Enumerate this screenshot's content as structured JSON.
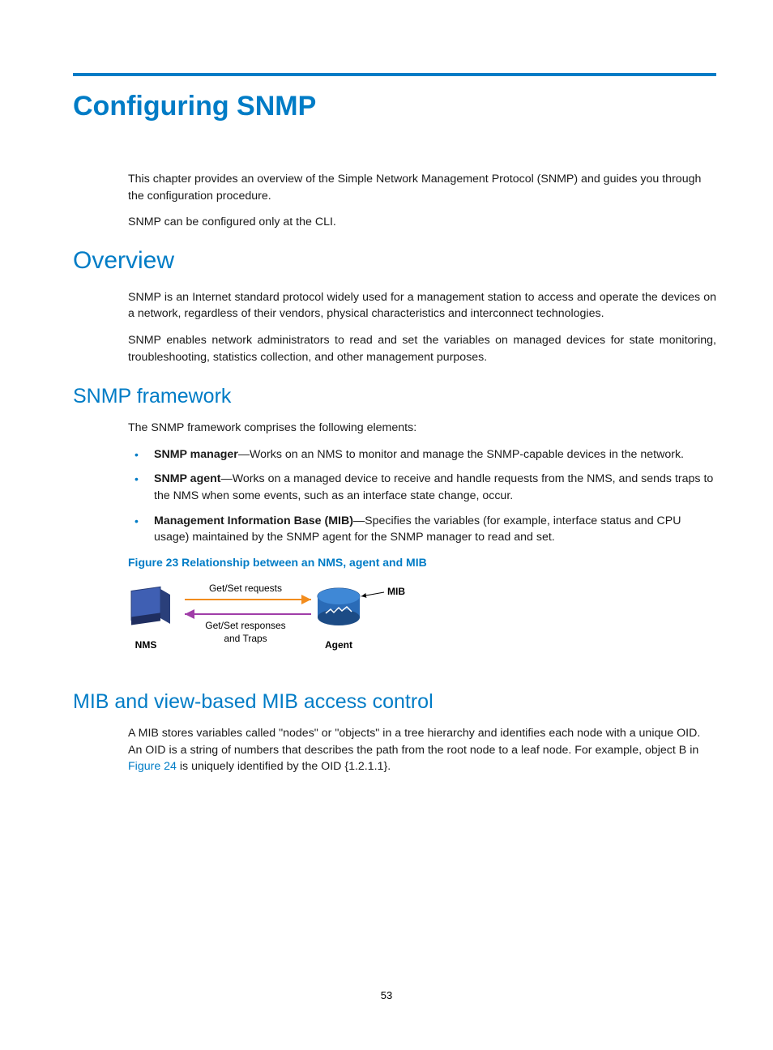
{
  "title": "Configuring SNMP",
  "intro": {
    "p1": "This chapter provides an overview of the Simple Network Management Protocol (SNMP) and guides you through the configuration procedure.",
    "p2": "SNMP can be configured only at the CLI."
  },
  "overview": {
    "heading": "Overview",
    "p1": "SNMP is an Internet standard protocol widely used for a management station to access and operate the devices on a network, regardless of their vendors, physical characteristics and interconnect technologies.",
    "p2": "SNMP enables network administrators to read and set the variables on managed devices for state monitoring, troubleshooting, statistics collection, and other management purposes."
  },
  "framework": {
    "heading": "SNMP framework",
    "lead": "The SNMP framework comprises the following elements:",
    "bullets": [
      {
        "term": "SNMP manager",
        "desc": "—Works on an NMS to monitor and manage the SNMP-capable devices in the network."
      },
      {
        "term": "SNMP agent",
        "desc": "—Works on a managed device to receive and handle requests from the NMS, and sends traps to the NMS when some events, such as an interface state change, occur."
      },
      {
        "term": "Management Information Base (MIB)",
        "desc": "—Specifies the variables (for example, interface status and CPU usage) maintained by the SNMP agent for the SNMP manager to read and set."
      }
    ],
    "figure_caption": "Figure 23 Relationship between an NMS, agent and MIB",
    "figure_labels": {
      "nms": "NMS",
      "agent": "Agent",
      "mib": "MIB",
      "req": "Get/Set requests",
      "resp1": "Get/Set responses",
      "resp2": "and Traps"
    }
  },
  "mib": {
    "heading": "MIB and view-based MIB access control",
    "p1a": "A MIB stores variables called \"nodes\" or \"objects\" in a tree hierarchy and identifies each node with a unique OID. An OID is a string of numbers that describes the path from the root node to a leaf node. For example, object B in ",
    "link": "Figure 24",
    "p1b": " is uniquely identified by the OID {1.2.1.1}."
  },
  "page_number": "53"
}
